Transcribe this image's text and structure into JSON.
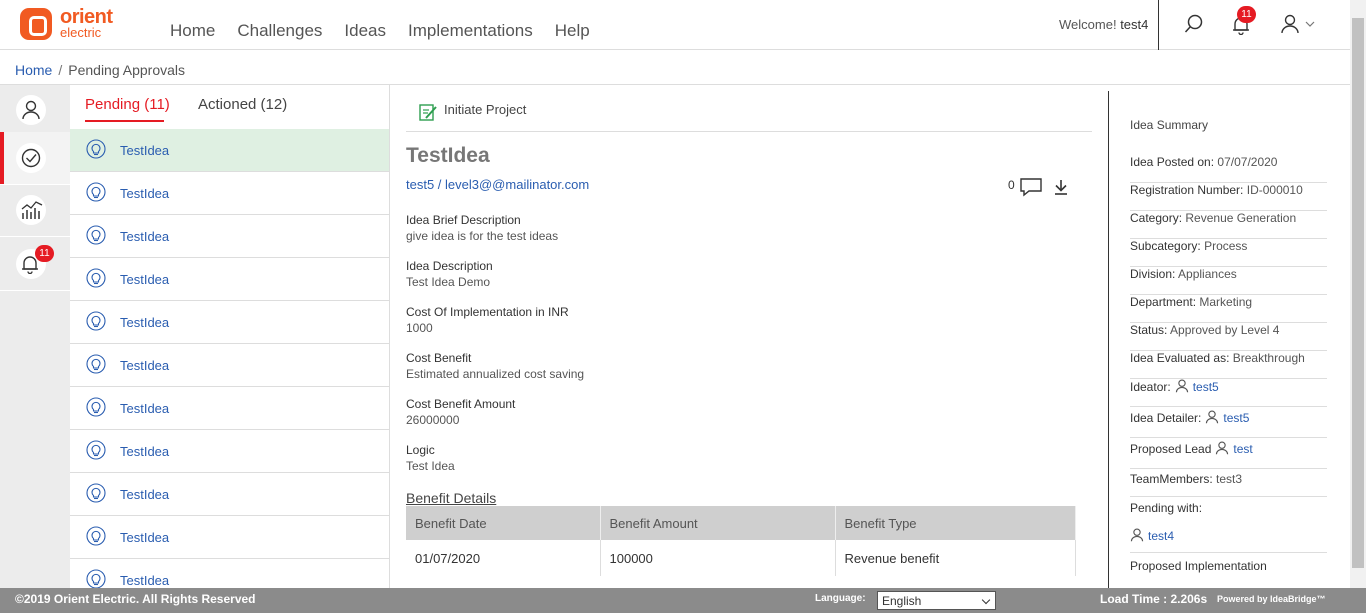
{
  "brand": {
    "line1": "orient",
    "line2": "electric"
  },
  "nav": [
    "Home",
    "Challenges",
    "Ideas",
    "Implementations",
    "Help"
  ],
  "header": {
    "welcome": "Welcome!",
    "user": "test4",
    "notifications": "11"
  },
  "breadcrumb": {
    "home": "Home",
    "separator": "/",
    "current": "Pending Approvals"
  },
  "rail": {
    "notifications": "11"
  },
  "tabs": {
    "pending": "Pending (11)",
    "actioned": "Actioned (12)"
  },
  "list": [
    "TestIdea",
    "TestIdea",
    "TestIdea",
    "TestIdea",
    "TestIdea",
    "TestIdea",
    "TestIdea",
    "TestIdea",
    "TestIdea",
    "TestIdea",
    "TestIdea"
  ],
  "detail": {
    "initiate": "Initiate Project",
    "title": "TestIdea",
    "submitter": "test5 / level3@@mailinator.com",
    "comment_count": "0",
    "fields": [
      {
        "k": "Idea Brief Description",
        "v": "give idea is for the test ideas"
      },
      {
        "k": "Idea Description",
        "v": "Test Idea Demo"
      },
      {
        "k": "Cost Of Implementation in INR",
        "v": "1000"
      },
      {
        "k": "Cost Benefit",
        "v": "Estimated annualized cost saving"
      },
      {
        "k": "Cost Benefit Amount",
        "v": "26000000"
      },
      {
        "k": "Logic",
        "v": "Test Idea"
      }
    ],
    "benefit_heading": "Benefit Details",
    "benefit_columns": [
      "Benefit Date",
      "Benefit Amount",
      "Benefit Type"
    ],
    "benefit_rows": [
      [
        "01/07/2020",
        "100000",
        "Revenue benefit"
      ]
    ]
  },
  "summary": {
    "heading": "Idea Summary",
    "posted": {
      "k": "Idea Posted on:",
      "v": "07/07/2020"
    },
    "reg": {
      "k": "Registration Number:",
      "v": "ID-000010"
    },
    "category": {
      "k": "Category:",
      "v": "Revenue Generation"
    },
    "subcategory": {
      "k": "Subcategory:",
      "v": "Process"
    },
    "division": {
      "k": "Division:",
      "v": "Appliances"
    },
    "department": {
      "k": "Department:",
      "v": "Marketing"
    },
    "status": {
      "k": "Status:",
      "v": "Approved by Level 4"
    },
    "evaluated": {
      "k": "Idea Evaluated as:",
      "v": "Breakthrough"
    },
    "ideator": {
      "k": "Ideator:",
      "v": "test5"
    },
    "detailer": {
      "k": "Idea Detailer:",
      "v": "test5"
    },
    "lead": {
      "k": "Proposed Lead",
      "v": "test"
    },
    "team": {
      "k": "TeamMembers:",
      "v": "test3"
    },
    "pending": {
      "k": "Pending with:",
      "v": "test4"
    },
    "impl": {
      "k": "Proposed Implementation"
    }
  },
  "footer": {
    "copyright": "©2019 Orient Electric. All Rights Reserved",
    "language_label": "Language:",
    "language": "English",
    "load": "Load Time : 2.206s",
    "powered": "Powered by IdeaBridge™"
  },
  "colors": {
    "brand": "#f15a22",
    "accent": "#e51b23",
    "link": "#2a5db0",
    "selected_row": "#dff0e2"
  }
}
